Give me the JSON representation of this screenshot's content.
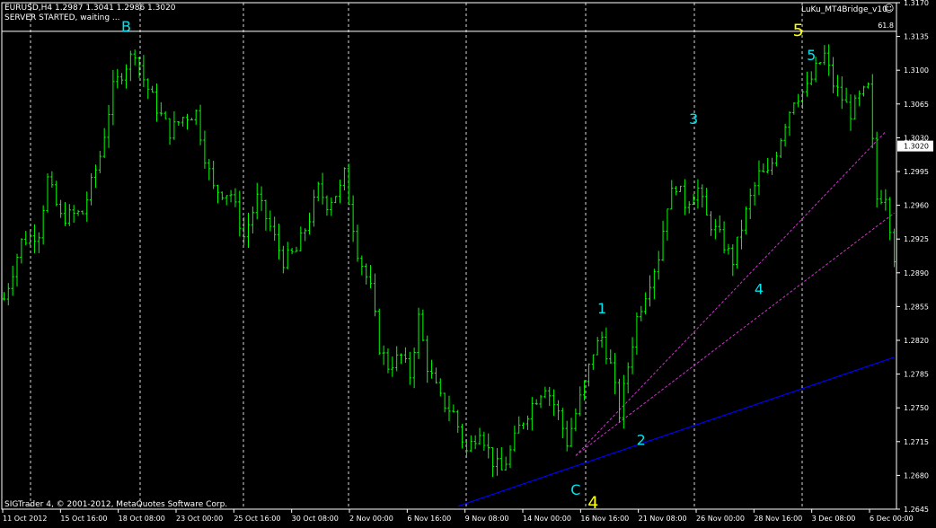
{
  "header": {
    "symbol_line": "EURUSD,H4  1.2987 1.3041 1.2986 1.3020",
    "status_line": "SERVER STARTED, waiting ...",
    "indicator_name": "LuKu_MT4Bridge_v10",
    "indicator_icon": "smiley-icon"
  },
  "footer": {
    "copyright": "SIGTrader 4, © 2001-2012, MetaQuotes Software Corp."
  },
  "colors": {
    "background": "#000000",
    "candles": "#00ff00",
    "grid": "#ffffff",
    "wave_labels": "#00e5ee",
    "major_wave_labels": "#ffff00",
    "trendline": "#0000ff",
    "channel_lines": "#cc33cc"
  },
  "chart_data": {
    "type": "candlestick",
    "symbol": "EURUSD",
    "timeframe": "H4",
    "current_price": 1.302,
    "fib_level_label": "61.8",
    "fib_level_price": 1.314,
    "ylim": [
      1.264,
      1.317
    ],
    "y_ticks": [
      "1.3170",
      "1.3135",
      "1.3100",
      "1.3065",
      "1.3030",
      "1.2995",
      "1.2960",
      "1.2925",
      "1.2890",
      "1.2855",
      "1.2820",
      "1.2785",
      "1.2750",
      "1.2715",
      "1.2680",
      "1.2645"
    ],
    "x_ticks": [
      "11 Oct 2012",
      "15 Oct 16:00",
      "18 Oct 08:00",
      "23 Oct 00:00",
      "25 Oct 16:00",
      "30 Oct 08:00",
      "2 Nov 00:00",
      "6 Nov 16:00",
      "9 Nov 08:00",
      "14 Nov 00:00",
      "16 Nov 16:00",
      "21 Nov 08:00",
      "26 Nov 00:00",
      "28 Nov 16:00",
      "3 Dec 08:00",
      "6 Dec 00:00"
    ],
    "price_path": [
      [
        0,
        1.286
      ],
      [
        4,
        1.292
      ],
      [
        8,
        1.293
      ],
      [
        10,
        1.2985
      ],
      [
        13,
        1.2945
      ],
      [
        18,
        1.295
      ],
      [
        22,
        1.301
      ],
      [
        25,
        1.308
      ],
      [
        28,
        1.3105
      ],
      [
        30,
        1.312
      ],
      [
        32,
        1.309
      ],
      [
        35,
        1.306
      ],
      [
        38,
        1.3035
      ],
      [
        41,
        1.305
      ],
      [
        44,
        1.3055
      ],
      [
        46,
        1.301
      ],
      [
        48,
        1.2975
      ],
      [
        52,
        1.297
      ],
      [
        55,
        1.2925
      ],
      [
        58,
        1.2965
      ],
      [
        61,
        1.2935
      ],
      [
        64,
        1.29
      ],
      [
        67,
        1.291
      ],
      [
        70,
        1.2945
      ],
      [
        72,
        1.2975
      ],
      [
        74,
        1.296
      ],
      [
        77,
        1.2975
      ],
      [
        78,
        1.299
      ],
      [
        81,
        1.291
      ],
      [
        84,
        1.287
      ],
      [
        86,
        1.281
      ],
      [
        88,
        1.279
      ],
      [
        91,
        1.28
      ],
      [
        93,
        1.278
      ],
      [
        95,
        1.284
      ],
      [
        97,
        1.279
      ],
      [
        100,
        1.2755
      ],
      [
        103,
        1.274
      ],
      [
        106,
        1.27
      ],
      [
        109,
        1.2725
      ],
      [
        112,
        1.269
      ],
      [
        114,
        1.268
      ],
      [
        116,
        1.27
      ],
      [
        118,
        1.2725
      ],
      [
        121,
        1.275
      ],
      [
        124,
        1.277
      ],
      [
        127,
        1.274
      ],
      [
        129,
        1.271
      ],
      [
        131,
        1.274
      ],
      [
        133,
        1.277
      ],
      [
        135,
        1.2805
      ],
      [
        137,
        1.282
      ],
      [
        139,
        1.279
      ],
      [
        141,
        1.274
      ],
      [
        143,
        1.279
      ],
      [
        145,
        1.284
      ],
      [
        148,
        1.288
      ],
      [
        150,
        1.2905
      ],
      [
        152,
        1.296
      ],
      [
        154,
        1.298
      ],
      [
        156,
        1.296
      ],
      [
        159,
        1.2975
      ],
      [
        161,
        1.2945
      ],
      [
        164,
        1.2925
      ],
      [
        167,
        1.29
      ],
      [
        169,
        1.2935
      ],
      [
        171,
        1.2965
      ],
      [
        173,
        1.299
      ],
      [
        175,
        1.299
      ],
      [
        177,
        1.3015
      ],
      [
        179,
        1.3045
      ],
      [
        181,
        1.307
      ],
      [
        184,
        1.308
      ],
      [
        186,
        1.31
      ],
      [
        188,
        1.3115
      ],
      [
        190,
        1.3085
      ],
      [
        192,
        1.307
      ],
      [
        194,
        1.3055
      ],
      [
        196,
        1.307
      ],
      [
        198,
        1.308
      ],
      [
        200,
        1.2965
      ],
      [
        202,
        1.297
      ],
      [
        204,
        1.2905
      ]
    ],
    "annotations": [
      {
        "text": "B",
        "style": "wave",
        "bar": 28,
        "price": 1.314
      },
      {
        "text": "5",
        "style": "major",
        "bar": 182,
        "price": 1.3135
      },
      {
        "text": "5",
        "style": "wave",
        "bar": 185,
        "price": 1.311
      },
      {
        "text": "3",
        "style": "wave",
        "bar": 158,
        "price": 1.3043
      },
      {
        "text": "1",
        "style": "wave",
        "bar": 137,
        "price": 1.2845
      },
      {
        "text": "4",
        "style": "wave",
        "bar": 173,
        "price": 1.2865
      },
      {
        "text": "2",
        "style": "wave",
        "bar": 146,
        "price": 1.2707
      },
      {
        "text": "C",
        "style": "wave",
        "bar": 131,
        "price": 1.2655
      },
      {
        "text": "4",
        "style": "major",
        "bar": 135,
        "price": 1.2641
      }
    ],
    "trendline": {
      "from": [
        104,
        1.2643
      ],
      "to": [
        204,
        1.2799
      ]
    },
    "channel_lines": [
      {
        "from": [
          131,
          1.2696
        ],
        "to": [
          202,
          1.3035
        ]
      },
      {
        "from": [
          131,
          1.2696
        ],
        "to": [
          204,
          1.295
        ]
      }
    ]
  }
}
